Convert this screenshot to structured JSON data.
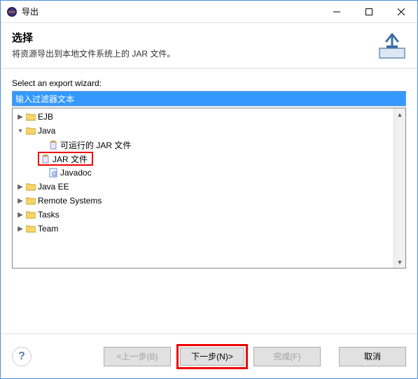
{
  "window": {
    "title": "导出"
  },
  "header": {
    "title": "选择",
    "description": "将资源导出到本地文件系统上的 JAR 文件。"
  },
  "body": {
    "wizard_label": "Select an export wizard:",
    "filter_value": "输入过滤器文本"
  },
  "tree": {
    "ejb": "EJB",
    "java": "Java",
    "java_runnable": "可运行的 JAR 文件",
    "java_jar": "JAR 文件",
    "java_javadoc": "Javadoc",
    "javaee": "Java EE",
    "remote": "Remote Systems",
    "tasks": "Tasks",
    "team": "Team"
  },
  "footer": {
    "back": "<上一步(B)",
    "next": "下一步(N)>",
    "finish": "完成(F)",
    "cancel": "取消",
    "help": "?"
  }
}
